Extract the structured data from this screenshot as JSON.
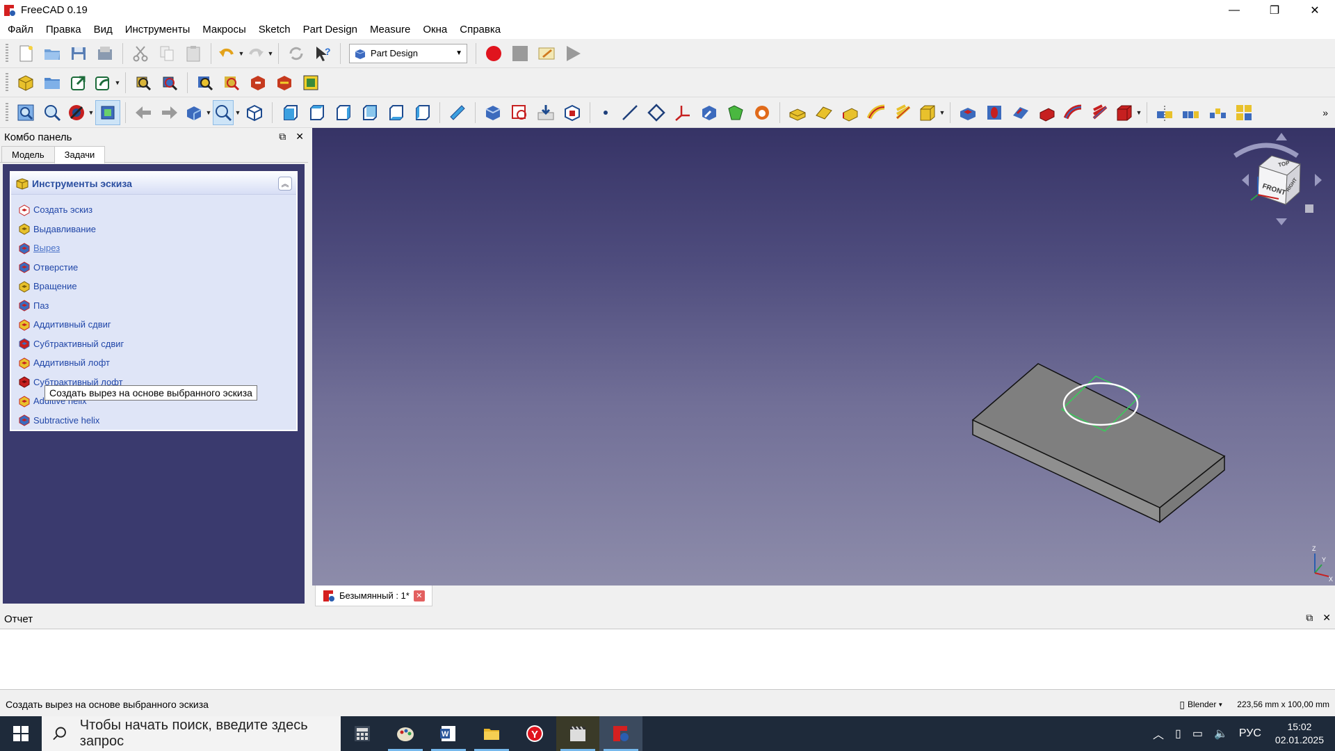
{
  "window": {
    "title": "FreeCAD 0.19",
    "minimize": "—",
    "maximize": "❐",
    "close": "✕"
  },
  "menu": [
    "Файл",
    "Правка",
    "Вид",
    "Инструменты",
    "Макросы",
    "Sketch",
    "Part Design",
    "Measure",
    "Окна",
    "Справка"
  ],
  "toolbar": {
    "workbench": "Part Design",
    "overflow": "»"
  },
  "combo": {
    "title": "Комбо панель",
    "tabs": [
      "Модель",
      "Задачи"
    ],
    "task_title": "Инструменты эскиза",
    "items": [
      {
        "label": "Создать эскиз",
        "icon": "sketch-icon"
      },
      {
        "label": "Выдавливание",
        "icon": "pad-icon"
      },
      {
        "label": "Вырез",
        "icon": "pocket-icon"
      },
      {
        "label": "Отверстие",
        "icon": "hole-icon"
      },
      {
        "label": "Вращение",
        "icon": "revolution-icon"
      },
      {
        "label": "Паз",
        "icon": "groove-icon"
      },
      {
        "label": "Аддитивный сдвиг",
        "icon": "additive-pipe-icon"
      },
      {
        "label": "Субтрактивный сдвиг",
        "icon": "subtractive-pipe-icon"
      },
      {
        "label": "Аддитивный лофт",
        "icon": "additive-loft-icon"
      },
      {
        "label": "Субтрактивный лофт",
        "icon": "subtractive-loft-icon"
      },
      {
        "label": "Additive helix",
        "icon": "additive-helix-icon"
      },
      {
        "label": "Subtractive helix",
        "icon": "subtractive-helix-icon"
      }
    ],
    "tooltip": "Создать вырез на основе выбранного эскиза"
  },
  "viewport": {
    "cube_top": "TOP",
    "cube_front": "FRONT",
    "cube_right": "RIGHT",
    "axis_z": "Z",
    "axis_y": "Y",
    "axis_x": "X"
  },
  "document_tab": "Безымянный : 1*",
  "report": {
    "title": "Отчет"
  },
  "status": {
    "message": "Создать вырез на основе выбранного эскиза",
    "nav_style": "Blender",
    "dimensions": "223,56 mm x 100,00 mm"
  },
  "taskbar": {
    "search_placeholder": "Чтобы начать поиск, введите здесь запрос",
    "lang": "РУС",
    "time": "15:02",
    "date": "02.01.2025"
  },
  "colors": {
    "viewport_top": "#363366",
    "viewport_bottom": "#8d8caa",
    "task_text": "#2046a8",
    "record": "#e0141e"
  }
}
